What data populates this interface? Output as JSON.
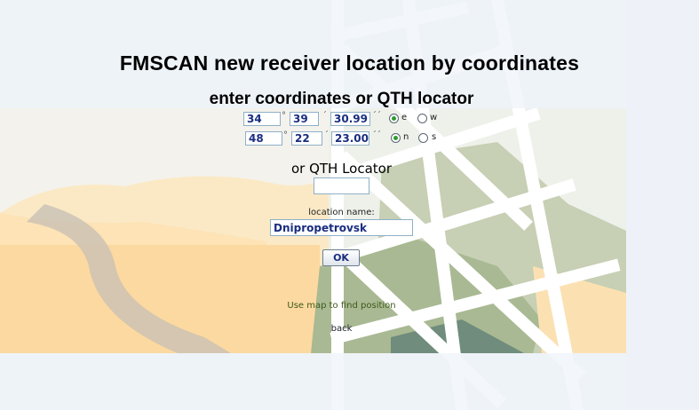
{
  "page": {
    "title": "FMSCAN new receiver location by coordinates",
    "subtitle": "enter coordinates or QTH locator"
  },
  "longitude": {
    "degrees": "34",
    "minutes": "39",
    "seconds": "30.99",
    "degree_symbol": "°",
    "minute_symbol": "´",
    "second_symbol": "´´",
    "east_label": "e",
    "west_label": "w",
    "selected": "e"
  },
  "latitude": {
    "degrees": "48",
    "minutes": "22",
    "seconds": "23.00",
    "degree_symbol": "°",
    "minute_symbol": "´",
    "second_symbol": "´´",
    "north_label": "n",
    "south_label": "s",
    "selected": "n"
  },
  "qth": {
    "label": "or QTH Locator",
    "value": ""
  },
  "location": {
    "label": "location name:",
    "value": "Dnipropetrovsk"
  },
  "buttons": {
    "ok_label": "OK"
  },
  "links": {
    "map_label": "Use map to find position",
    "back_label": "back"
  }
}
